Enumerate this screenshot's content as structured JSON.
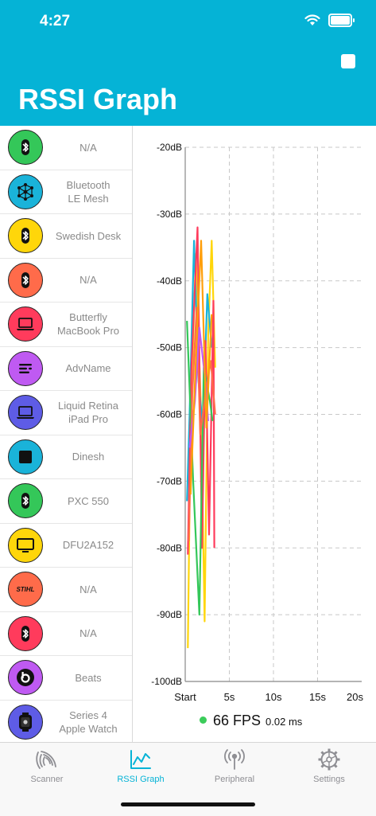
{
  "status_bar": {
    "time": "4:27"
  },
  "header": {
    "title": "RSSI Graph",
    "stop_icon": "stop-icon"
  },
  "devices": [
    {
      "name": "N/A",
      "icon": "bluetooth-icon",
      "color": "#34c759"
    },
    {
      "name": "Bluetooth\nLE Mesh",
      "icon": "mesh-icon",
      "color": "#1ab3d9"
    },
    {
      "name": "Swedish Desk",
      "icon": "bluetooth-icon",
      "color": "#ffd60a"
    },
    {
      "name": "N/A",
      "icon": "bluetooth-icon",
      "color": "#ff6b4a"
    },
    {
      "name": "Butterfly\nMacBook Pro",
      "icon": "laptop-icon",
      "color": "#ff3b5c"
    },
    {
      "name": "AdvName",
      "icon": "lines-icon",
      "color": "#bf5af2"
    },
    {
      "name": "Liquid Retina\niPad Pro",
      "icon": "laptop-icon",
      "color": "#5e5ce6"
    },
    {
      "name": "Dinesh",
      "icon": "square-icon",
      "color": "#1ab3d9"
    },
    {
      "name": "PXC 550",
      "icon": "bluetooth-icon",
      "color": "#34c759"
    },
    {
      "name": "DFU2A152",
      "icon": "monitor-icon",
      "color": "#ffd60a"
    },
    {
      "name": "N/A",
      "icon": "stihl-icon",
      "color": "#ff6b4a"
    },
    {
      "name": "N/A",
      "icon": "bluetooth-icon",
      "color": "#ff3b5c"
    },
    {
      "name": "Beats",
      "icon": "beats-icon",
      "color": "#bf5af2"
    },
    {
      "name": "Series 4\nApple Watch",
      "icon": "watch-icon",
      "color": "#5e5ce6"
    }
  ],
  "chart_data": {
    "type": "line",
    "x_ticks": [
      "Start",
      "5s",
      "10s",
      "15s",
      "20s"
    ],
    "xlim": [
      0,
      20
    ],
    "ylim": [
      -100,
      -20
    ],
    "y_ticks": [
      "-20dB",
      "-30dB",
      "-40dB",
      "-50dB",
      "-60dB",
      "-70dB",
      "-80dB",
      "-90dB",
      "-100dB"
    ],
    "y_tick_values": [
      -20,
      -30,
      -40,
      -50,
      -60,
      -70,
      -80,
      -90,
      -100
    ],
    "grid": true,
    "series": [
      {
        "color": "#ffd60a",
        "points": [
          [
            0.3,
            -95
          ],
          [
            0.6,
            -62
          ],
          [
            1.2,
            -36
          ],
          [
            1.8,
            -60
          ],
          [
            2.2,
            -91
          ],
          [
            2.6,
            -48
          ],
          [
            3.0,
            -34
          ],
          [
            3.4,
            -53
          ]
        ]
      },
      {
        "color": "#1ab3d9",
        "points": [
          [
            0.2,
            -73
          ],
          [
            0.5,
            -60
          ],
          [
            1.0,
            -34
          ],
          [
            1.5,
            -55
          ],
          [
            2.0,
            -62
          ],
          [
            2.5,
            -42
          ],
          [
            3.0,
            -50
          ]
        ]
      },
      {
        "color": "#ff3b5c",
        "points": [
          [
            0.3,
            -81
          ],
          [
            0.7,
            -53
          ],
          [
            1.4,
            -32
          ],
          [
            1.9,
            -80
          ],
          [
            2.3,
            -49
          ],
          [
            2.7,
            -78
          ],
          [
            3.2,
            -43
          ],
          [
            3.3,
            -80
          ]
        ]
      },
      {
        "color": "#34c759",
        "points": [
          [
            0.2,
            -46
          ],
          [
            0.9,
            -70
          ],
          [
            1.6,
            -90
          ],
          [
            2.1,
            -53
          ],
          [
            2.8,
            -58
          ],
          [
            3.1,
            -61
          ]
        ]
      },
      {
        "color": "#ff6b4a",
        "points": [
          [
            0.4,
            -79
          ],
          [
            0.8,
            -57
          ],
          [
            1.3,
            -44
          ],
          [
            1.7,
            -63
          ],
          [
            2.4,
            -56
          ],
          [
            2.9,
            -52
          ],
          [
            3.4,
            -60
          ]
        ]
      },
      {
        "color": "#bf5af2",
        "points": [
          [
            0.5,
            -65
          ],
          [
            1.1,
            -58
          ],
          [
            1.6,
            -47
          ],
          [
            2.2,
            -54
          ],
          [
            2.6,
            -61
          ]
        ]
      },
      {
        "color": "#ff9f0a",
        "points": [
          [
            0.6,
            -72
          ],
          [
            1.2,
            -52
          ],
          [
            1.8,
            -34
          ],
          [
            2.4,
            -62
          ],
          [
            3.0,
            -45
          ]
        ]
      }
    ]
  },
  "stats": {
    "fps": "66 FPS",
    "ms": "0.02 ms"
  },
  "tabs": [
    {
      "label": "Scanner",
      "icon": "scanner-icon",
      "active": false
    },
    {
      "label": "RSSI Graph",
      "icon": "graph-icon",
      "active": true
    },
    {
      "label": "Peripheral",
      "icon": "antenna-icon",
      "active": false
    },
    {
      "label": "Settings",
      "icon": "gear-icon",
      "active": false
    }
  ],
  "colors": {
    "accent": "#05b3d6",
    "inactive": "#8e8e93"
  }
}
